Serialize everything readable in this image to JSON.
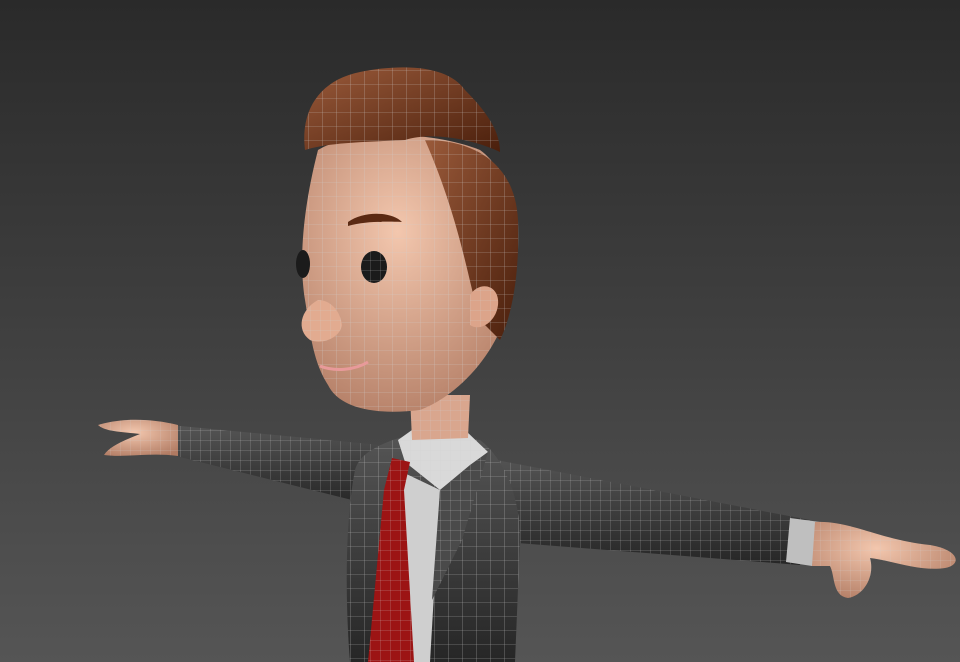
{
  "viewport": {
    "background_top": "#2a2a2a",
    "background_bottom": "#555555"
  },
  "character": {
    "skin": "#e8b49a",
    "skin_shadow": "#b57f66",
    "hair": "#5a2a14",
    "hair_light": "#8a4a30",
    "suit": "#3b3b3b",
    "suit_light": "#4e4e4e",
    "shirt": "#d8d8d8",
    "tie": "#9c1414",
    "wire": "#cfcfcf",
    "eye": "#1b1b1b",
    "lip": "#e89a9a"
  }
}
